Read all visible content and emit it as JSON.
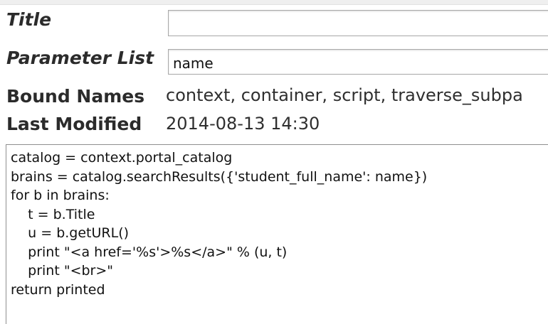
{
  "form": {
    "title_label": "Title",
    "title_value": "",
    "parameter_label": "Parameter List",
    "parameter_value": "name",
    "bound_names_label": "Bound Names",
    "bound_names_value": "context, container, script, traverse_subpa",
    "last_modified_label": "Last Modified",
    "last_modified_value": "2014-08-13 14:30"
  },
  "editor": {
    "lines": [
      "catalog = context.portal_catalog",
      "brains = catalog.searchResults({'student_full_name': name})",
      "for b in brains:",
      "    t = b.Title",
      "    u = b.getURL()",
      "    print \"<a href='%s'>%s</a>\" % (u, t)",
      "    print \"<br>\"",
      "return printed"
    ]
  }
}
